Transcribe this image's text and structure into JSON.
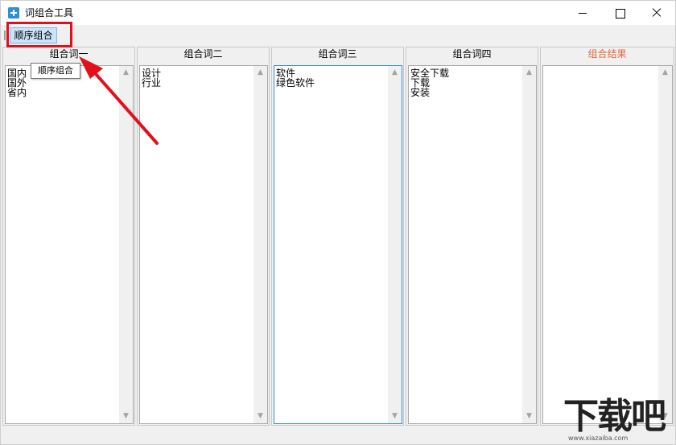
{
  "window": {
    "title": "词组合工具"
  },
  "toolbar": {
    "order_label": "顺序组合"
  },
  "tooltip": {
    "text": "顺序组合"
  },
  "columns": [
    {
      "header": "组合词一",
      "items": [
        "国内",
        "国外",
        "省内"
      ]
    },
    {
      "header": "组合词二",
      "items": [
        "设计",
        "行业"
      ]
    },
    {
      "header": "组合词三",
      "items": [
        "软件",
        "绿色软件"
      ]
    },
    {
      "header": "组合词四",
      "items": [
        "安全下载",
        "下载",
        "安装"
      ]
    },
    {
      "header": "组合结果",
      "items": []
    }
  ],
  "colors": {
    "highlight": "#e3101c",
    "result_header": "#e06a3a",
    "button_bg": "#cce4f7"
  },
  "watermark": {
    "text": "下载吧",
    "url": "www.xiazaiba.com"
  }
}
